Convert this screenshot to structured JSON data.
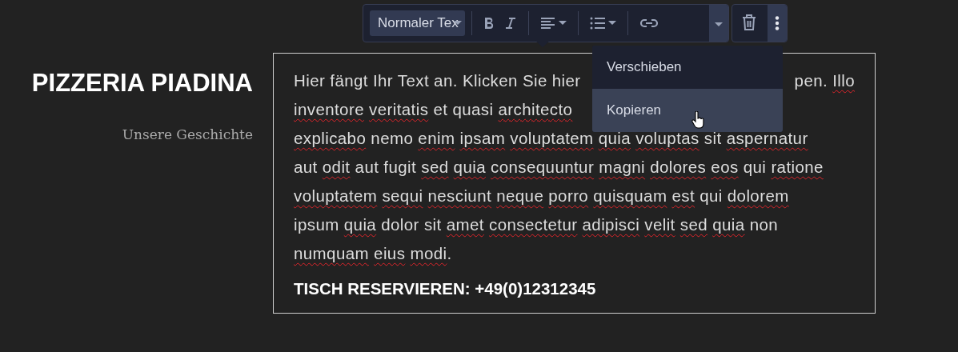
{
  "sidebar": {
    "title": "PIZZERIA PIADINA",
    "subtitle": "Unsere Geschichte"
  },
  "toolbar": {
    "style_select": "Normaler Tex",
    "more_menu_open": true
  },
  "menu": {
    "items": [
      {
        "label": "Verschieben",
        "selected": false
      },
      {
        "label": "Kopieren",
        "selected": true
      }
    ]
  },
  "text_block": {
    "lines": [
      [
        [
          {
            "text": "Hier fängt Ihr Text an. Klicken Sie hier",
            "misspelled": false
          }
        ],
        [
          {
            "text": "pen.",
            "misspelled": false
          },
          {
            "text": "Illo",
            "misspelled": true
          }
        ]
      ],
      [
        [
          {
            "text": "inventore",
            "misspelled": true
          },
          {
            "text": "veritatis",
            "misspelled": true
          },
          {
            "text": "et quasi",
            "misspelled": false
          },
          {
            "text": "architecto",
            "misspelled": true
          }
        ]
      ],
      [
        [
          {
            "text": "explicabo",
            "misspelled": true
          },
          {
            "text": "nemo",
            "misspelled": false
          },
          {
            "text": "enim",
            "misspelled": true
          },
          {
            "text": "ipsam",
            "misspelled": true
          },
          {
            "text": "voluptatem",
            "misspelled": true
          },
          {
            "text": "quia",
            "misspelled": true
          },
          {
            "text": "voluptas",
            "misspelled": true
          },
          {
            "text": "sit",
            "misspelled": false
          },
          {
            "text": "aspernatur",
            "misspelled": true
          }
        ]
      ],
      [
        [
          {
            "text": "aut",
            "misspelled": false
          },
          {
            "text": "odit",
            "misspelled": true
          },
          {
            "text": "aut fugit",
            "misspelled": false
          },
          {
            "text": "sed",
            "misspelled": true
          },
          {
            "text": "quia",
            "misspelled": true
          },
          {
            "text": "consequuntur",
            "misspelled": true
          },
          {
            "text": "magni",
            "misspelled": true
          },
          {
            "text": "dolores",
            "misspelled": true
          },
          {
            "text": "eos",
            "misspelled": true
          },
          {
            "text": "qui",
            "misspelled": false
          },
          {
            "text": "ratione",
            "misspelled": true
          }
        ]
      ],
      [
        [
          {
            "text": "voluptatem",
            "misspelled": true
          },
          {
            "text": "sequi",
            "misspelled": true
          },
          {
            "text": "nesciunt",
            "misspelled": true
          },
          {
            "text": "neque",
            "misspelled": true
          },
          {
            "text": "porro",
            "misspelled": true
          },
          {
            "text": "quisquam",
            "misspelled": true
          },
          {
            "text": "est",
            "misspelled": true
          },
          {
            "text": "qui",
            "misspelled": false
          },
          {
            "text": "dolorem",
            "misspelled": true
          }
        ]
      ],
      [
        [
          {
            "text": "ipsum",
            "misspelled": false
          },
          {
            "text": "quia",
            "misspelled": true
          },
          {
            "text": "dolor sit",
            "misspelled": false
          },
          {
            "text": "amet",
            "misspelled": true
          },
          {
            "text": "consectetur",
            "misspelled": true
          },
          {
            "text": "adipisci",
            "misspelled": true
          },
          {
            "text": "velit",
            "misspelled": true
          },
          {
            "text": "sed",
            "misspelled": true
          },
          {
            "text": "quia",
            "misspelled": true
          },
          {
            "text": "non",
            "misspelled": false
          }
        ]
      ],
      [
        [
          {
            "text": "numquam",
            "misspelled": true
          },
          {
            "text": "eius",
            "misspelled": true
          },
          {
            "text": "modi",
            "misspelled": true
          },
          {
            "text": ".",
            "misspelled": false,
            "attached": true
          }
        ]
      ]
    ],
    "reservation": "TISCH RESERVIEREN: +49(0)12312345"
  }
}
